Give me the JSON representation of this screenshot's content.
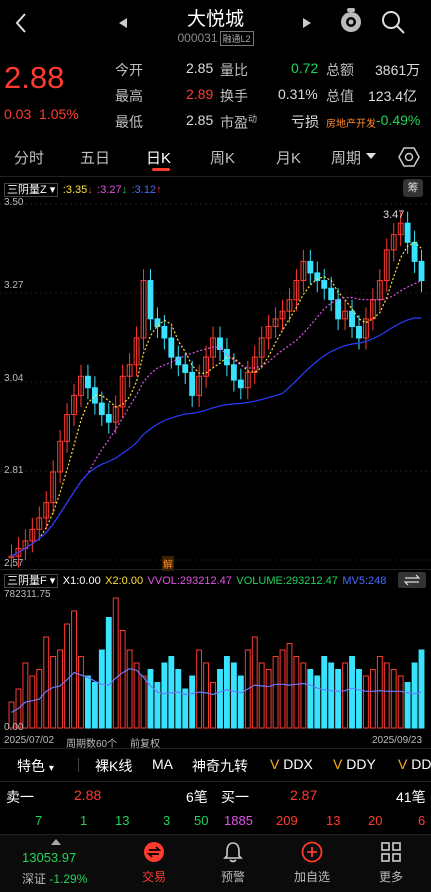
{
  "header": {
    "title": "大悦城",
    "code": "000031",
    "badge": "融通L2"
  },
  "quote": {
    "price": "2.88",
    "change": "0.03",
    "change_pct": "1.05%",
    "open_label": "今开",
    "open": "2.85",
    "high_label": "最高",
    "high": "2.89",
    "low_label": "最低",
    "low": "2.85",
    "vol_ratio_label": "量比",
    "vol_ratio": "0.72",
    "turnover_label": "换手",
    "turnover": "0.31%",
    "pe_label": "市盈",
    "pe_sup": "动",
    "pe": "亏损",
    "amount_label": "总额",
    "amount": "3861万",
    "mcap_label": "总值",
    "mcap": "123.4亿",
    "sector": "房地产开发",
    "sector_change": "-0.49%"
  },
  "tabs": [
    "分时",
    "五日",
    "日K",
    "周K",
    "月K",
    "周期"
  ],
  "active_tab": "日K",
  "main_indicator": {
    "name": "三阴量Z",
    "v1": ":3.35",
    "v2": ":3.27",
    "v3": ":3.12",
    "chip_label": "筹"
  },
  "price_axis": [
    "3.50",
    "3.27",
    "3.04",
    "2.81",
    "2.57"
  ],
  "high_marker": "3.47",
  "unlock_label": "解",
  "sub_indicator": {
    "name": "三阴量F",
    "x1": "X1:0.00",
    "x2": "X2:0.00",
    "vvol": "VVOL:293212.47",
    "volume": "VOLUME:293212.47",
    "mv5": "MV5:248"
  },
  "vol_axis": [
    "782311.75",
    "0.00"
  ],
  "date_start": "2025/07/02",
  "period_count": "周期数60个",
  "adjust": "前复权",
  "date_end": "2025/09/23",
  "toolbar": [
    "特色",
    "裸K线",
    "MA",
    "神奇九转",
    "DDX",
    "DDY",
    "DD"
  ],
  "orderbook": {
    "sell1_label": "卖一",
    "sell1_price": "2.88",
    "sell1_vol": "6笔",
    "buy1_label": "买一",
    "buy1_price": "2.87",
    "buy1_vol": "41笔",
    "sell_detail": [
      "7",
      "1",
      "13",
      "3",
      "50"
    ],
    "buy_detail": [
      "1885",
      "209",
      "13",
      "20",
      "6"
    ]
  },
  "index": {
    "value": "13053.97",
    "name": "深证",
    "change": "-1.29%"
  },
  "bottom_nav": [
    "交易",
    "预警",
    "加自选",
    "更多"
  ],
  "chart_data": {
    "type": "candlestick",
    "title": "",
    "ylim": [
      2.57,
      3.5
    ],
    "high": 3.47
  }
}
